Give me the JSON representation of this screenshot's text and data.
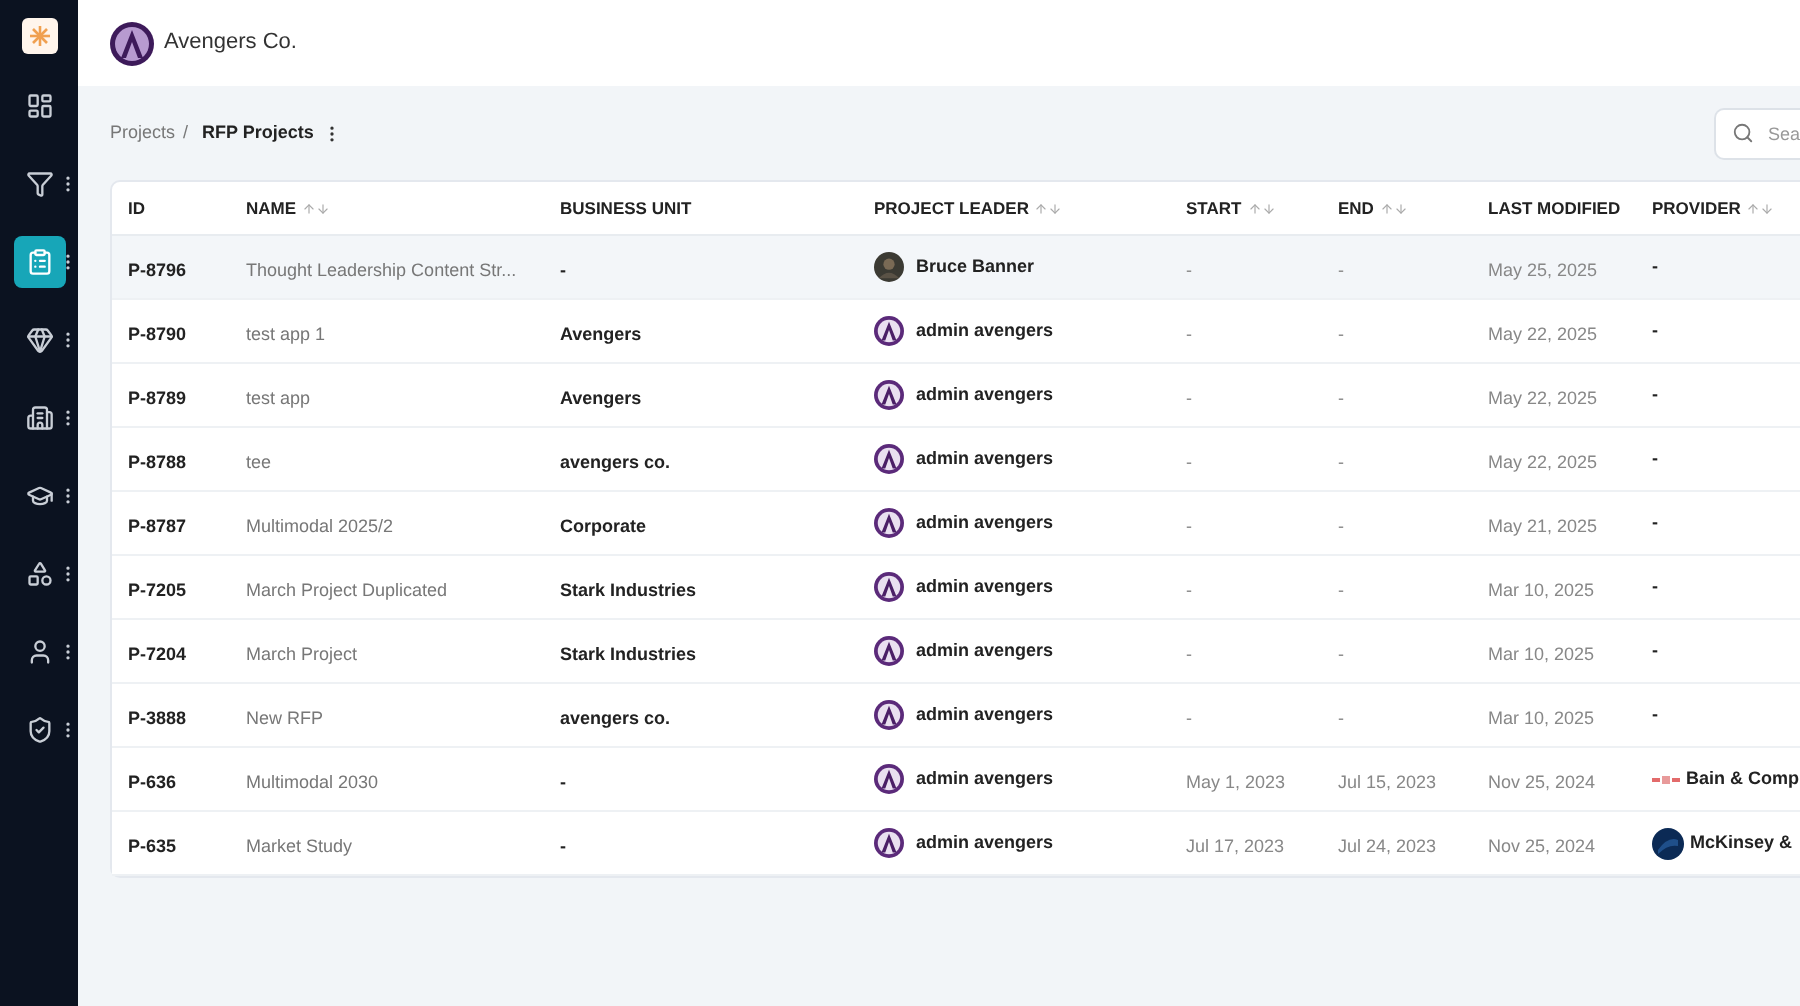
{
  "sidebar": {
    "items": [
      {
        "selected": false,
        "has_menu": false
      },
      {
        "selected": false,
        "has_menu": true
      },
      {
        "selected": true,
        "has_menu": true
      },
      {
        "selected": false,
        "has_menu": true
      },
      {
        "selected": false,
        "has_menu": true
      },
      {
        "selected": false,
        "has_menu": true
      },
      {
        "selected": false,
        "has_menu": true
      },
      {
        "selected": false,
        "has_menu": true
      },
      {
        "selected": false,
        "has_menu": true
      }
    ]
  },
  "header": {
    "company": "Avengers Co."
  },
  "breadcrumb": {
    "items": [
      "Projects",
      "RFP Projects"
    ],
    "separator": "/"
  },
  "search": {
    "placeholder": "Sea"
  },
  "table": {
    "columns": [
      {
        "label": "ID",
        "sortable": false
      },
      {
        "label": "NAME",
        "sortable": true
      },
      {
        "label": "BUSINESS UNIT",
        "sortable": false
      },
      {
        "label": "PROJECT LEADER",
        "sortable": true
      },
      {
        "label": "START",
        "sortable": true
      },
      {
        "label": "END",
        "sortable": true
      },
      {
        "label": "LAST MODIFIED",
        "sortable": false
      },
      {
        "label": "PROVIDER",
        "sortable": true
      }
    ],
    "rows": [
      {
        "selected": true,
        "id": "P-8796",
        "name": "Thought Leadership Content Str...",
        "business_unit": "-",
        "leader": {
          "name": "Bruce Banner",
          "kind": "photo"
        },
        "start": "-",
        "end": "-",
        "last_modified": "May 25, 2025",
        "provider": {
          "name": "-",
          "kind": "none"
        }
      },
      {
        "selected": false,
        "id": "P-8790",
        "name": "test app 1",
        "business_unit": "Avengers",
        "leader": {
          "name": "admin avengers",
          "kind": "logo"
        },
        "start": "-",
        "end": "-",
        "last_modified": "May 22, 2025",
        "provider": {
          "name": "-",
          "kind": "none"
        }
      },
      {
        "selected": false,
        "id": "P-8789",
        "name": "test app",
        "business_unit": "Avengers",
        "leader": {
          "name": "admin avengers",
          "kind": "logo"
        },
        "start": "-",
        "end": "-",
        "last_modified": "May 22, 2025",
        "provider": {
          "name": "-",
          "kind": "none"
        }
      },
      {
        "selected": false,
        "id": "P-8788",
        "name": "tee",
        "business_unit": "avengers co.",
        "leader": {
          "name": "admin avengers",
          "kind": "logo"
        },
        "start": "-",
        "end": "-",
        "last_modified": "May 22, 2025",
        "provider": {
          "name": "-",
          "kind": "none"
        }
      },
      {
        "selected": false,
        "id": "P-8787",
        "name": "Multimodal 2025/2",
        "business_unit": "Corporate",
        "leader": {
          "name": "admin avengers",
          "kind": "logo"
        },
        "start": "-",
        "end": "-",
        "last_modified": "May 21, 2025",
        "provider": {
          "name": "-",
          "kind": "none"
        }
      },
      {
        "selected": false,
        "id": "P-7205",
        "name": "March Project Duplicated",
        "business_unit": "Stark Industries",
        "leader": {
          "name": "admin avengers",
          "kind": "logo"
        },
        "start": "-",
        "end": "-",
        "last_modified": "Mar 10, 2025",
        "provider": {
          "name": "-",
          "kind": "none"
        }
      },
      {
        "selected": false,
        "id": "P-7204",
        "name": "March Project",
        "business_unit": "Stark Industries",
        "leader": {
          "name": "admin avengers",
          "kind": "logo"
        },
        "start": "-",
        "end": "-",
        "last_modified": "Mar 10, 2025",
        "provider": {
          "name": "-",
          "kind": "none"
        }
      },
      {
        "selected": false,
        "id": "P-3888",
        "name": "New RFP",
        "business_unit": "avengers co.",
        "leader": {
          "name": "admin avengers",
          "kind": "logo"
        },
        "start": "-",
        "end": "-",
        "last_modified": "Mar 10, 2025",
        "provider": {
          "name": "-",
          "kind": "none"
        }
      },
      {
        "selected": false,
        "id": "P-636",
        "name": "Multimodal 2030",
        "business_unit": "-",
        "leader": {
          "name": "admin avengers",
          "kind": "logo"
        },
        "start": "May 1, 2023",
        "end": "Jul 15, 2023",
        "last_modified": "Nov 25, 2024",
        "provider": {
          "name": "Bain & Comp",
          "kind": "wordmark"
        }
      },
      {
        "selected": false,
        "id": "P-635",
        "name": "Market Study",
        "business_unit": "-",
        "leader": {
          "name": "admin avengers",
          "kind": "logo"
        },
        "start": "Jul 17, 2023",
        "end": "Jul 24, 2023",
        "last_modified": "Nov 25, 2024",
        "provider": {
          "name": "McKinsey &",
          "kind": "circle"
        }
      }
    ]
  }
}
